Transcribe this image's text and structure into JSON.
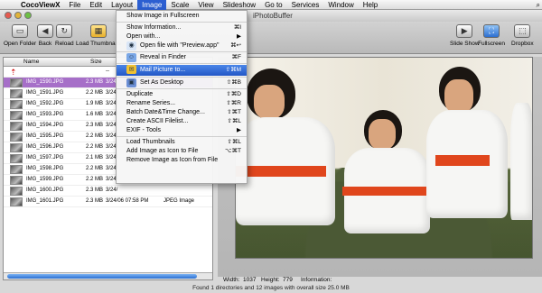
{
  "menubar": {
    "apple": "",
    "items": [
      "CocoViewX",
      "File",
      "Edit",
      "Layout",
      "Image",
      "Scale",
      "View",
      "Slideshow",
      "Go to",
      "Services",
      "Window",
      "Help"
    ],
    "active_index": 4
  },
  "window": {
    "title": "iPhotoBuffer"
  },
  "toolbar": {
    "left": [
      "Open Folder",
      "Back",
      "Reload",
      "Load Thumbnails"
    ],
    "right": [
      "Slide Show",
      "Fullscreen",
      "Dropbox"
    ]
  },
  "browser": {
    "columns": [
      "Name",
      "Size"
    ],
    "rows": [
      {
        "name": "",
        "size": "",
        "date": "--",
        "kind": "",
        "selected": false
      },
      {
        "name": "IMG_1590.JPG",
        "size": "2.3 MB",
        "date": "3/24/",
        "kind": "",
        "selected": true
      },
      {
        "name": "IMG_1591.JPG",
        "size": "2.2 MB",
        "date": "3/24/",
        "kind": "",
        "selected": false
      },
      {
        "name": "IMG_1592.JPG",
        "size": "1.9 MB",
        "date": "3/24/",
        "kind": "",
        "selected": false
      },
      {
        "name": "IMG_1593.JPG",
        "size": "1.6 MB",
        "date": "3/24/",
        "kind": "",
        "selected": false
      },
      {
        "name": "IMG_1594.JPG",
        "size": "2.3 MB",
        "date": "3/24/",
        "kind": "",
        "selected": false
      },
      {
        "name": "IMG_1595.JPG",
        "size": "2.2 MB",
        "date": "3/24/",
        "kind": "",
        "selected": false
      },
      {
        "name": "IMG_1596.JPG",
        "size": "2.2 MB",
        "date": "3/24/",
        "kind": "",
        "selected": false
      },
      {
        "name": "IMG_1597.JPG",
        "size": "2.1 MB",
        "date": "3/24/",
        "kind": "",
        "selected": false
      },
      {
        "name": "IMG_1598.JPG",
        "size": "2.2 MB",
        "date": "3/24/",
        "kind": "",
        "selected": false
      },
      {
        "name": "IMG_1599.JPG",
        "size": "2.2 MB",
        "date": "3/24/",
        "kind": "",
        "selected": false
      },
      {
        "name": "IMG_1600.JPG",
        "size": "2.3 MB",
        "date": "3/24/",
        "kind": "",
        "selected": false
      },
      {
        "name": "IMG_1601.JPG",
        "size": "2.3 MB",
        "date": "3/24/06 07:58 PM",
        "kind": "JPEG Image",
        "selected": false
      }
    ]
  },
  "image_menu": {
    "items": [
      {
        "label": "Show Image in Fullscreen",
        "shortcut": "",
        "icon": "",
        "indent": false
      },
      {
        "sep": true
      },
      {
        "label": "Show Information...",
        "shortcut": "⌘I",
        "icon": "",
        "indent": false
      },
      {
        "label": "Open with...",
        "shortcut": "▶",
        "icon": "",
        "indent": false
      },
      {
        "label": "Open file with \"Preview.app\"",
        "shortcut": "⌘↩",
        "icon": "preview-icon",
        "indent": true
      },
      {
        "sep": true
      },
      {
        "label": "Reveal in Finder",
        "shortcut": "⌘F",
        "icon": "finder-icon",
        "indent": true
      },
      {
        "sep": true
      },
      {
        "label": "Mail Picture to...",
        "shortcut": "⇧⌘M",
        "icon": "mail-icon",
        "indent": true,
        "highlighted": true
      },
      {
        "sep": true
      },
      {
        "label": "Set As Desktop",
        "shortcut": "⇧⌘B",
        "icon": "desktop-icon",
        "indent": true
      },
      {
        "sep": true
      },
      {
        "label": "Duplicate",
        "shortcut": "⇧⌘D",
        "icon": "",
        "indent": false
      },
      {
        "label": "Rename Series...",
        "shortcut": "⇧⌘R",
        "icon": "",
        "indent": false
      },
      {
        "label": "Batch Date&Time Change...",
        "shortcut": "⇧⌘T",
        "icon": "",
        "indent": false
      },
      {
        "label": "Create ASCII Filelist...",
        "shortcut": "⇧⌘L",
        "icon": "",
        "indent": false
      },
      {
        "label": "EXIF - Tools",
        "shortcut": "▶",
        "icon": "",
        "indent": false
      },
      {
        "sep": true
      },
      {
        "label": "Load Thumbnails",
        "shortcut": "⇧⌘L",
        "icon": "",
        "indent": false
      },
      {
        "label": "Add Image as Icon to File",
        "shortcut": "⌥⌘T",
        "icon": "",
        "indent": false
      },
      {
        "label": "Remove Image as Icon from File",
        "shortcut": "",
        "icon": "",
        "indent": false
      }
    ]
  },
  "infobar": {
    "width_label": "Width:",
    "width_value": "1037",
    "height_label": "Height:",
    "height_value": "779",
    "info_label": "Information:"
  },
  "status": "Found 1 directories and 12 images with overall size 25.0 MB"
}
